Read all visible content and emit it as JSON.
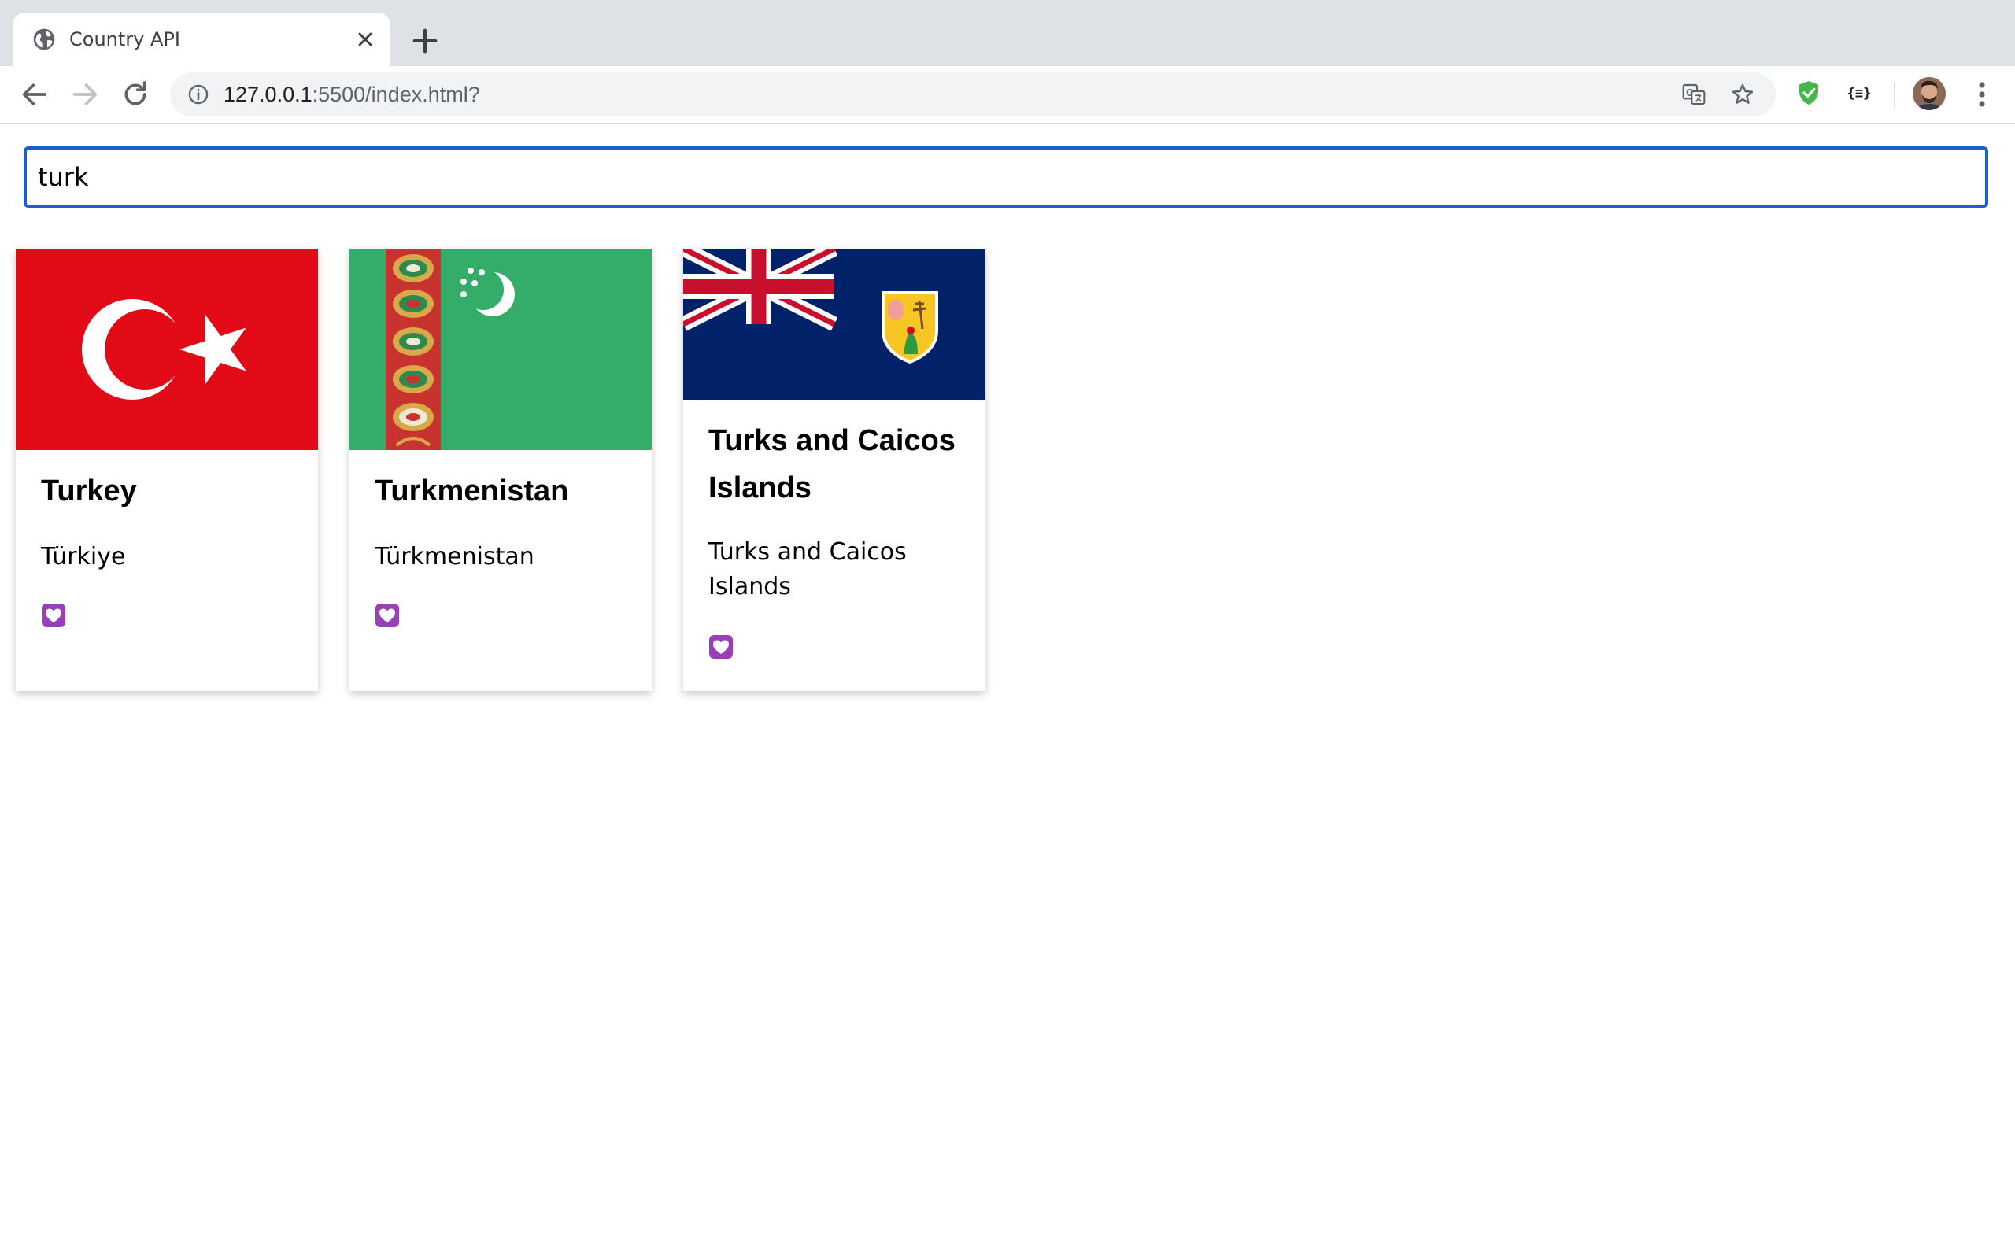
{
  "browser": {
    "tab": {
      "title": "Country API",
      "icon": "globe-icon",
      "close_icon": "close-icon"
    },
    "new_tab_icon": "plus-icon",
    "toolbar": {
      "back_icon": "back-arrow-icon",
      "forward_icon": "forward-arrow-icon",
      "reload_icon": "reload-icon",
      "site_info_icon": "info-icon",
      "url_host": "127.0.0.1",
      "url_rest": ":5500/index.html?",
      "translate_icon": "translate-icon",
      "bookmark_icon": "star-icon",
      "extensions": [
        "shield-check-icon",
        "json-formatter-icon"
      ],
      "json_ext_label": "{≡}",
      "menu_icon": "kebab-menu-icon"
    }
  },
  "search": {
    "value": "turk",
    "placeholder": ""
  },
  "countries": [
    {
      "name": "Turkey",
      "native_name": "Türkiye",
      "flag": "turkey-flag",
      "favorite_icon": "purple-heart-icon"
    },
    {
      "name": "Turkmenistan",
      "native_name": "Türkmenistan",
      "flag": "turkmenistan-flag",
      "favorite_icon": "purple-heart-icon"
    },
    {
      "name": "Turks and Caicos Islands",
      "native_name": "Turks and Caicos Islands",
      "flag": "turks-caicos-flag",
      "favorite_icon": "purple-heart-icon"
    }
  ],
  "colors": {
    "accent_focus": "#1a5fd0",
    "turkey_red": "#e30a17",
    "turkmen_green": "#34ad6a",
    "tci_blue": "#012169",
    "favorite_purple": "#9b3fb8"
  }
}
